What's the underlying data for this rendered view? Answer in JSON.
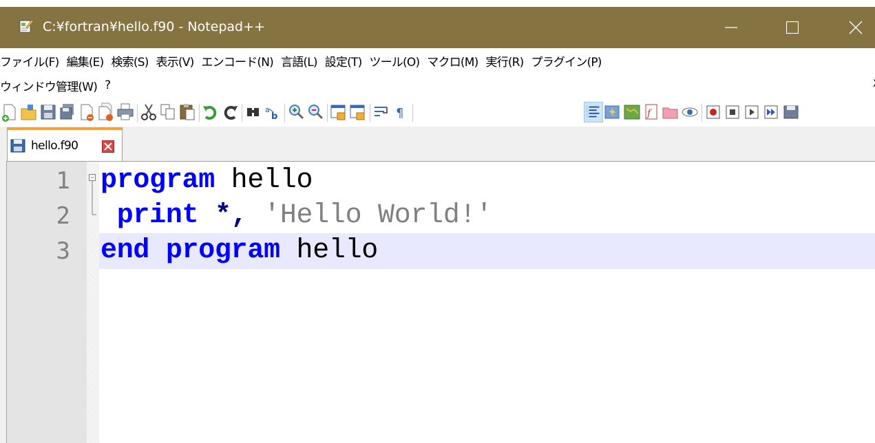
{
  "window": {
    "title": "C:¥fortran¥hello.f90 - Notepad++"
  },
  "menu": {
    "row1": [
      "ファイル(F)",
      "編集(E)",
      "検索(S)",
      "表示(V)",
      "エンコード(N)",
      "言語(L)",
      "設定(T)",
      "ツール(O)",
      "マクロ(M)",
      "実行(R)",
      "プラグイン(P)"
    ],
    "row2": [
      "ウィンドウ管理(W)",
      "?"
    ],
    "edge": "X"
  },
  "tab": {
    "label": "hello.f90"
  },
  "editor": {
    "lines": [
      {
        "number": "1",
        "tokens": [
          {
            "kind": "kw",
            "text": "program"
          },
          {
            "kind": "plain",
            "text": " hello"
          }
        ]
      },
      {
        "number": "2",
        "tokens": [
          {
            "kind": "plain",
            "text": " "
          },
          {
            "kind": "kw",
            "text": "print"
          },
          {
            "kind": "plain",
            "text": " "
          },
          {
            "kind": "op",
            "text": "*,"
          },
          {
            "kind": "plain",
            "text": " "
          },
          {
            "kind": "str",
            "text": "'Hello World!'"
          }
        ]
      },
      {
        "number": "3",
        "tokens": [
          {
            "kind": "kw",
            "text": "end"
          },
          {
            "kind": "plain",
            "text": " "
          },
          {
            "kind": "kw",
            "text": "program"
          },
          {
            "kind": "plain",
            "text": " hello"
          }
        ]
      }
    ],
    "current_line": "3"
  },
  "colors": {
    "titlebar": "#857441",
    "keyword": "#0000ff",
    "operator": "#000080",
    "string": "#808080",
    "current_line": "#e8e8ff",
    "tab_accent": "#f4a23c"
  },
  "toolbar_icons": [
    "new-file-icon",
    "open-file-icon",
    "save-icon",
    "save-all-icon",
    "close-icon",
    "close-all-icon",
    "print-icon",
    "cut-icon",
    "copy-icon",
    "paste-icon",
    "undo-icon",
    "redo-icon",
    "find-icon",
    "replace-icon",
    "zoom-in-icon",
    "zoom-out-icon",
    "sync-vertical-icon",
    "sync-horizontal-icon",
    "word-wrap-icon",
    "show-all-characters-icon",
    "indent-guide-icon",
    "user-language-icon",
    "document-map-icon",
    "function-list-icon",
    "folder-workspace-icon",
    "monitoring-icon",
    "record-macro-icon",
    "stop-recording-icon",
    "playback-icon",
    "run-macro-multiple-icon",
    "save-macro-icon"
  ]
}
